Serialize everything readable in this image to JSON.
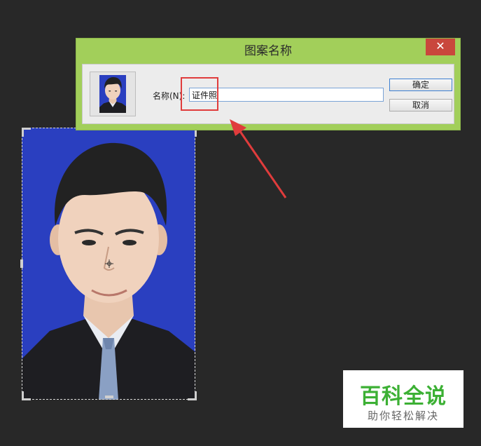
{
  "dialog": {
    "title": "图案名称",
    "close_glyph": "✕",
    "name_label": "名称(N):",
    "name_value": "证件照",
    "ok_label": "确定",
    "cancel_label": "取消"
  },
  "watermark": {
    "title": "百科全说",
    "subtitle": "助你轻松解决"
  },
  "icons": {
    "close": "close-icon",
    "crosshair": "crosshair-icon",
    "arrow": "red-arrow-icon"
  },
  "colors": {
    "background": "#282828",
    "dialog_frame": "#a2cf5a",
    "photo_background": "#2a3fc0",
    "highlight": "#e03c3c",
    "close_button": "#c9473c",
    "watermark_green": "#3cb034"
  }
}
